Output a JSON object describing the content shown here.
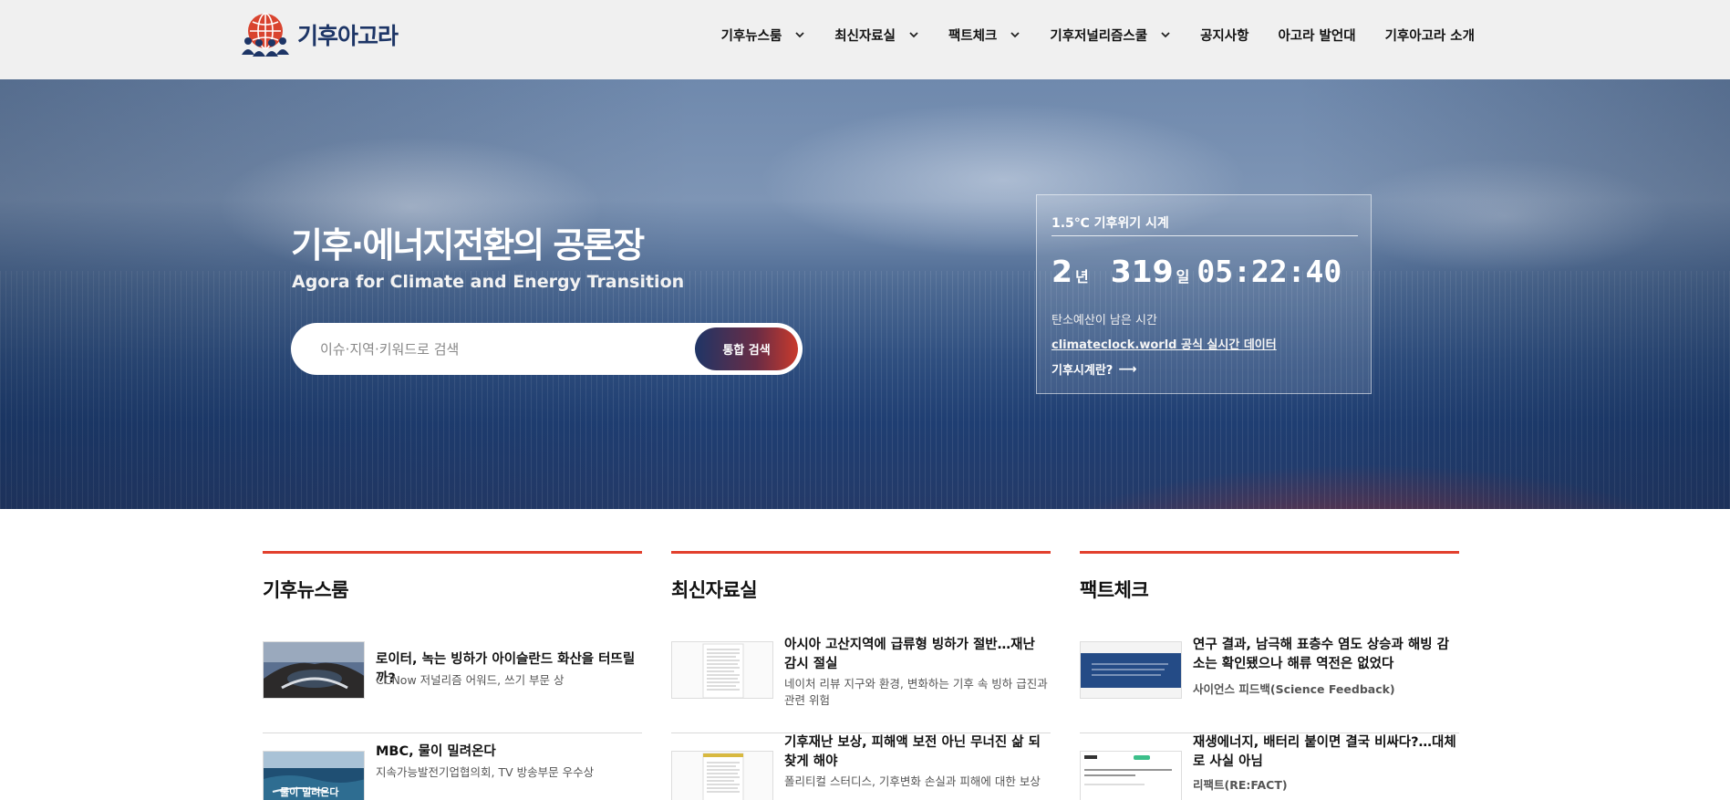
{
  "header": {
    "logo_text": "기후아고라",
    "nav": [
      {
        "label": "기후뉴스룸",
        "dropdown": true
      },
      {
        "label": "최신자료실",
        "dropdown": true
      },
      {
        "label": "팩트체크",
        "dropdown": true
      },
      {
        "label": "기후저널리즘스쿨",
        "dropdown": true
      },
      {
        "label": "공지사항",
        "dropdown": false
      },
      {
        "label": "아고라 발언대",
        "dropdown": false
      },
      {
        "label": "기후아고라 소개",
        "dropdown": false
      }
    ]
  },
  "hero": {
    "title": "기후·에너지전환의 공론장",
    "subtitle": "Agora for Climate and Energy Transition",
    "search": {
      "placeholder": "이슈·지역·키워드로 검색",
      "button_label": "통합 검색"
    },
    "clock": {
      "title": "1.5℃ 기후위기 시계",
      "years": "2",
      "years_unit": "년",
      "days": "319",
      "days_unit": "일",
      "time": "05:22:40",
      "remaining_label": "탄소예산이 남은 시간",
      "source_link": "climateclock.world 공식 실시간 데이터",
      "more_label": "기후시계란?",
      "more_arrow": "⟶"
    }
  },
  "sections": [
    {
      "heading": "기후뉴스룸",
      "items": [
        {
          "title": "로이터, 녹는 빙하가 아이슬란드 화산을 터뜨릴까?",
          "meta": "CCNow 저널리즘 어워드, 쓰기 부문 상",
          "thumb": "volcano"
        },
        {
          "title": "MBC, 물이 밀려온다",
          "meta": "지속가능발전기업협의회, TV 방송부문 우수상",
          "thumb": "flood",
          "thumb_text": "물이 밀려온다"
        }
      ]
    },
    {
      "heading": "최신자료실",
      "items": [
        {
          "title": "아시아 고산지역에 급류형 빙하가 절반…재난 감시 절실",
          "meta": "네이처 리뷰 지구와 환경, 변화하는 기후 속 빙하 급진과 관련 위험",
          "thumb": "document"
        },
        {
          "title": "기후재난 보상, 피해액 보전 아닌 무너진 삶 되찾게 해야",
          "meta": "폴리티컬 스터디스, 기후변화 손실과 피해에 대한 보상",
          "thumb": "document-color"
        }
      ]
    },
    {
      "heading": "팩트체크",
      "items": [
        {
          "title": "연구 결과, 남극해 표층수 염도 상승과 해빙 감소는 확인됐으나 해류 역전은 없었다",
          "meta": "사이언스 피드백(Science Feedback)",
          "thumb": "banner-blue"
        },
        {
          "title": "재생에너지, 배터리 붙이면 결국 비싸다?…대체로 사실 아님",
          "meta": "리팩트(RE:FACT)",
          "thumb": "refact"
        }
      ]
    }
  ],
  "colors": {
    "accent_red": "#e2402d",
    "navy": "#1d3566",
    "header_bg": "#f0f0f0"
  }
}
